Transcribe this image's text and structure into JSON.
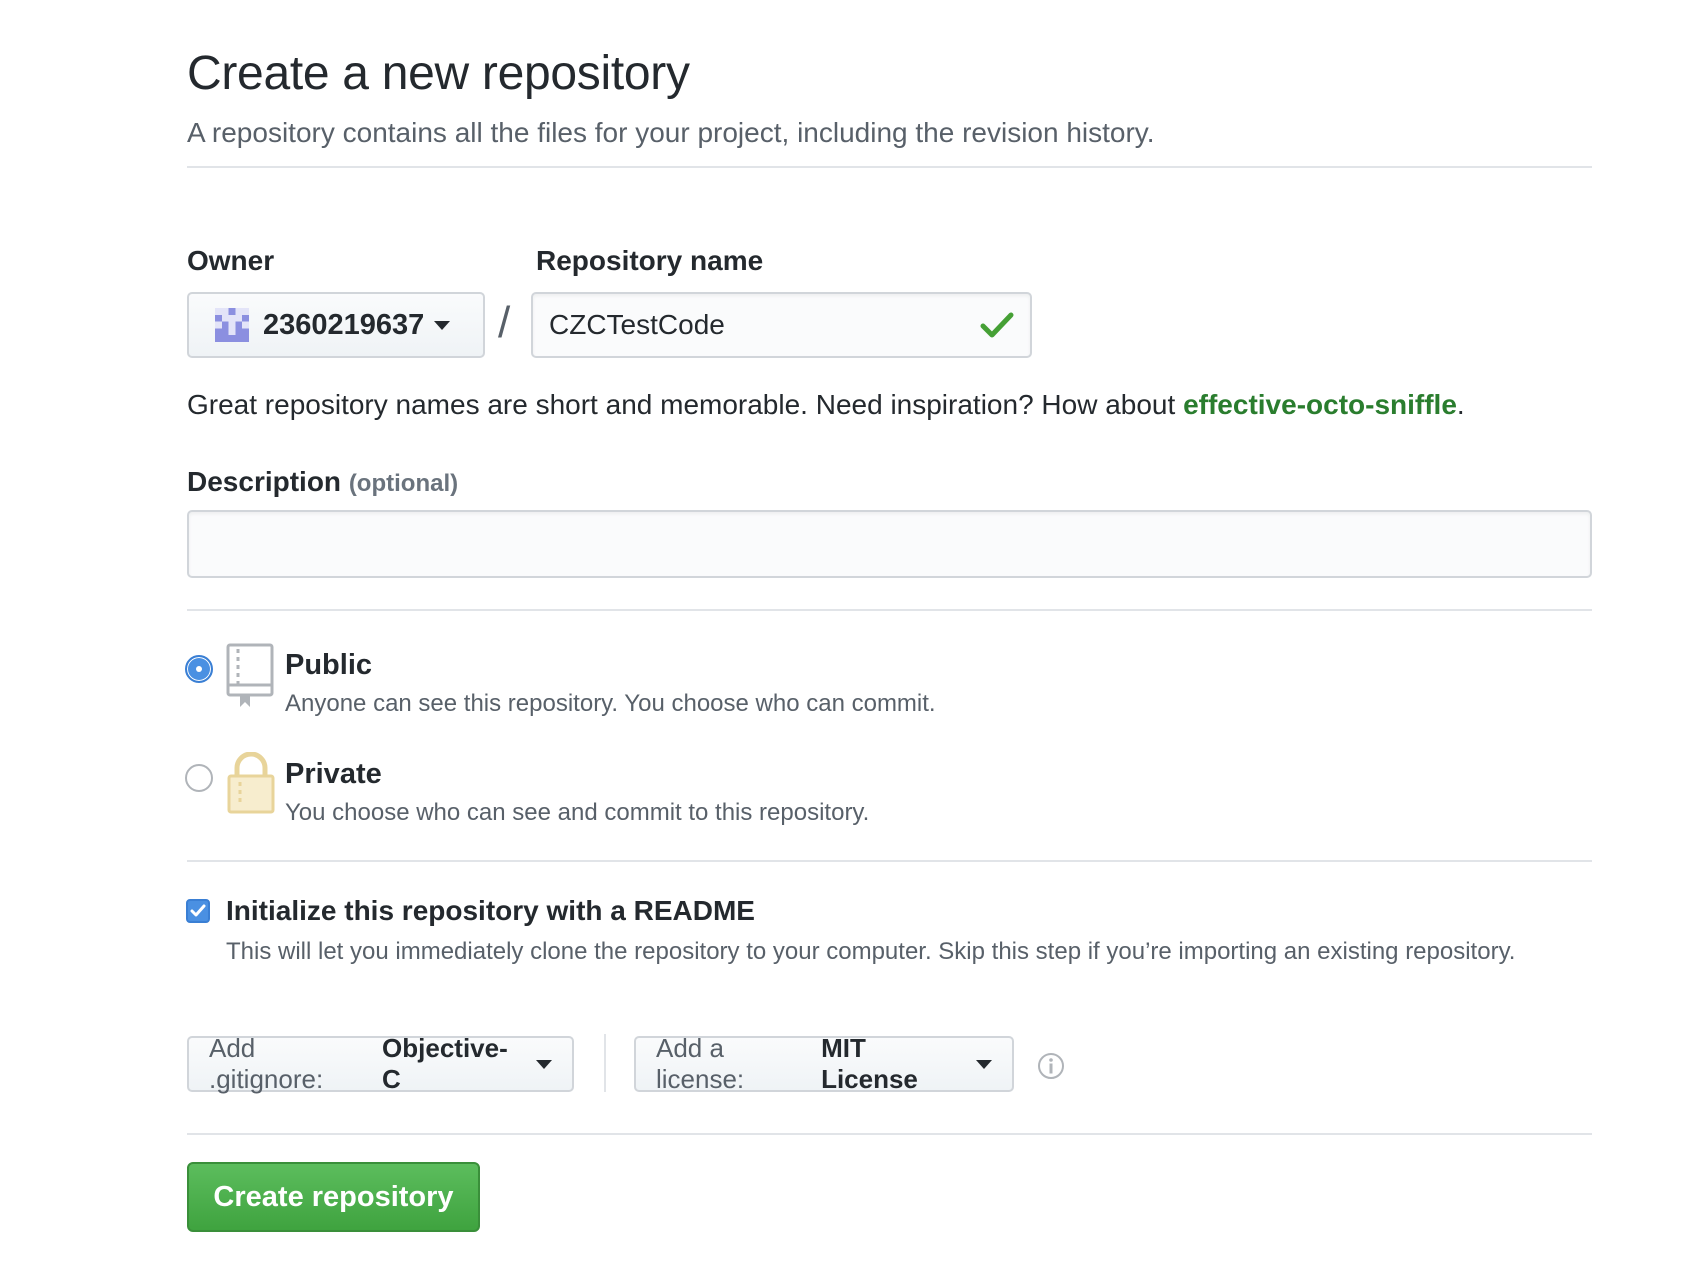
{
  "header": {
    "title": "Create a new repository",
    "subtitle": "A repository contains all the files for your project, including the revision history."
  },
  "owner": {
    "label": "Owner",
    "value": "2360219637",
    "avatar_icon": "identicon-avatar"
  },
  "separator": "/",
  "repo_name": {
    "label": "Repository name",
    "value": "CZCTestCode",
    "status_icon": "check-icon",
    "status_color": "#45a035"
  },
  "hint": {
    "text": "Great repository names are short and memorable. Need inspiration? How about ",
    "suggestion": "effective-octo-sniffle",
    "suffix": "."
  },
  "description": {
    "label": "Description",
    "optional": "(optional)",
    "value": "",
    "placeholder": ""
  },
  "visibility": {
    "selected": "public",
    "options": [
      {
        "id": "public",
        "title": "Public",
        "desc": "Anyone can see this repository. You choose who can commit.",
        "icon": "repo-book-icon"
      },
      {
        "id": "private",
        "title": "Private",
        "desc": "You choose who can see and commit to this repository.",
        "icon": "lock-icon"
      }
    ]
  },
  "init_readme": {
    "checked": true,
    "title": "Initialize this repository with a README",
    "desc": "This will let you immediately clone the repository to your computer. Skip this step if you’re importing an existing repository."
  },
  "gitignore": {
    "prefix": "Add .gitignore:",
    "value": "Objective-C"
  },
  "license": {
    "prefix": "Add a license:",
    "value": "MIT License"
  },
  "submit": {
    "label": "Create repository"
  },
  "colors": {
    "primary_green": "#4cae4c",
    "accent_blue": "#4a90e2",
    "link_green": "#2a7d2e"
  }
}
